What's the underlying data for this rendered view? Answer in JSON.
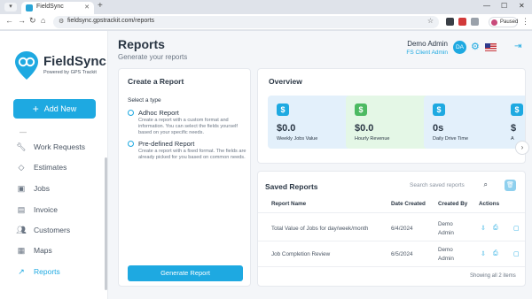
{
  "browser": {
    "tab_title": "FieldSync",
    "url": "fieldsync.gpstrackit.com/reports",
    "profile_status": "Paused"
  },
  "sidebar": {
    "brand": "FieldSync",
    "brand_sub": "Powered by GPS Trackit",
    "add_new": "Add New",
    "items": [
      {
        "label": "Work Requests",
        "icon": "wrench-icon"
      },
      {
        "label": "Estimates",
        "icon": "tag-icon"
      },
      {
        "label": "Jobs",
        "icon": "briefcase-icon"
      },
      {
        "label": "Invoice",
        "icon": "invoice-icon"
      },
      {
        "label": "Customers",
        "icon": "people-icon"
      },
      {
        "label": "Maps",
        "icon": "map-icon"
      },
      {
        "label": "Reports",
        "icon": "chart-line-icon"
      }
    ]
  },
  "header": {
    "title": "Reports",
    "subtitle": "Generate your reports",
    "user_name": "Demo Admin",
    "user_role": "FS Client Admin",
    "user_initials": "DA"
  },
  "create_report": {
    "title": "Create a Report",
    "select_label": "Select a type",
    "options": [
      {
        "label": "Adhoc Report",
        "desc": "Create a report with a custom format and information. You can select the fields yourself based on your specific needs."
      },
      {
        "label": "Pre-defined Report",
        "desc": "Create a report with a fixed format. The fields are already picked for you based on common needs."
      }
    ],
    "button": "Generate Report"
  },
  "overview": {
    "title": "Overview",
    "stats": [
      {
        "value": "$0.0",
        "label": "Weekly Jobs Value",
        "icon": "$",
        "bg": "#e3f0fb",
        "icon_bg": "#1ea9e1"
      },
      {
        "value": "$0.0",
        "label": "Hourly Revenue",
        "icon": "$",
        "bg": "#e4f7e6",
        "icon_bg": "#4cba62"
      },
      {
        "value": "0s",
        "label": "Daily Drive Time",
        "icon": "$",
        "bg": "#e3f0fb",
        "icon_bg": "#1ea9e1"
      },
      {
        "value": "$",
        "label": "A",
        "icon": "$",
        "bg": "#e3f0fb",
        "icon_bg": "#1ea9e1"
      }
    ]
  },
  "saved_reports": {
    "title": "Saved Reports",
    "search_placeholder": "Search saved reports",
    "columns": [
      "Report Name",
      "Date Created",
      "Created By",
      "Actions"
    ],
    "rows": [
      {
        "name": "Total Value of Jobs for day/week/month",
        "date": "6/4/2024",
        "by_1": "Demo",
        "by_2": "Admin"
      },
      {
        "name": "Job Completion Review",
        "date": "6/5/2024",
        "by_1": "Demo",
        "by_2": "Admin"
      }
    ],
    "footer": "Showing all 2 items"
  }
}
